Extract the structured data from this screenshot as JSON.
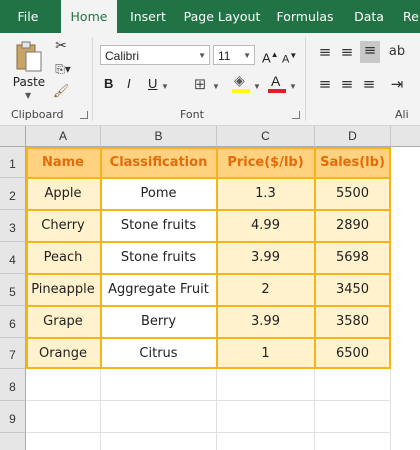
{
  "tabs": [
    {
      "label": "File",
      "active": false
    },
    {
      "label": "Home",
      "active": true
    },
    {
      "label": "Insert",
      "active": false
    },
    {
      "label": "Page Layout",
      "active": false
    },
    {
      "label": "Formulas",
      "active": false
    },
    {
      "label": "Data",
      "active": false
    },
    {
      "label": "Re",
      "active": false
    }
  ],
  "ribbon": {
    "clipboard": {
      "paste_label": "Paste",
      "group_label": "Clipboard"
    },
    "font": {
      "font_name": "Calibri",
      "font_size": "11",
      "bold": "B",
      "italic": "I",
      "underline": "U",
      "group_label": "Font"
    },
    "alignment": {
      "group_label": "Ali"
    }
  },
  "columns": [
    "A",
    "B",
    "C",
    "D"
  ],
  "rows": [
    "1",
    "2",
    "3",
    "4",
    "5",
    "6",
    "7",
    "8",
    "9"
  ],
  "table": {
    "headers": [
      "Name",
      "Classification",
      "Price($/lb)",
      "Sales(lb)"
    ],
    "data": [
      [
        "Apple",
        "Pome",
        "1.3",
        "5500"
      ],
      [
        "Cherry",
        "Stone fruits",
        "4.99",
        "2890"
      ],
      [
        "Peach",
        "Stone fruits",
        "3.99",
        "5698"
      ],
      [
        "Pineapple",
        "Aggregate Fruit",
        "2",
        "3450"
      ],
      [
        "Grape",
        "Berry",
        "3.99",
        "3580"
      ],
      [
        "Orange",
        "Citrus",
        "1",
        "6500"
      ]
    ]
  },
  "colors": {
    "accent": "#217346",
    "header_fill": "#ffd280",
    "header_text": "#e26b0a",
    "cell_fill": "#fff2cc",
    "border": "#f4b41a"
  },
  "icons": [
    "paste-icon",
    "cut-icon",
    "copy-icon",
    "format-painter-icon",
    "increase-font-icon",
    "decrease-font-icon",
    "borders-icon",
    "fill-color-icon",
    "font-color-icon",
    "align-top-icon",
    "align-middle-icon",
    "align-bottom-icon"
  ]
}
